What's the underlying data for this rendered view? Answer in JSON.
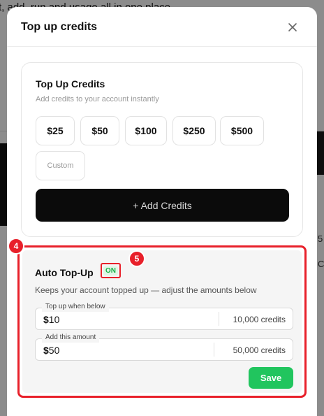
{
  "background": {
    "top_text": "t, add, run and usage all in one place",
    "right_text_1": "5",
    "right_text_2": "Co"
  },
  "modal": {
    "title": "Top up credits",
    "close_icon": "close-icon"
  },
  "topup": {
    "title": "Top Up Credits",
    "subtitle": "Add credits to your account instantly",
    "amounts": [
      "$25",
      "$50",
      "$100",
      "$250",
      "$500"
    ],
    "custom_placeholder": "Custom",
    "add_button": "+ Add Credits"
  },
  "auto": {
    "title": "Auto Top-Up",
    "status": "ON",
    "description": "Keeps your account topped up — adjust the amounts below",
    "threshold": {
      "label": "Top up when below",
      "currency": "$",
      "value": "10",
      "credits": "10,000 credits"
    },
    "amount": {
      "label": "Add this amount",
      "currency": "$",
      "value": "50",
      "credits": "50,000 credits"
    },
    "save_button": "Save"
  },
  "annotations": {
    "step_4": "4",
    "step_5": "5"
  },
  "colors": {
    "accent_red": "#e8202a",
    "save_green": "#21c55e",
    "on_green": "#1bb04b",
    "primary_black": "#0b0b0b"
  }
}
